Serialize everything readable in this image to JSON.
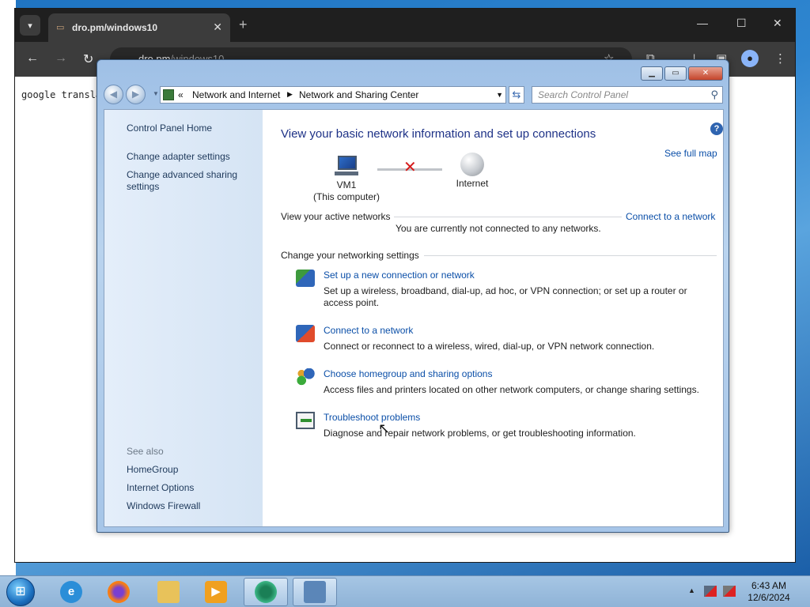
{
  "browser": {
    "tab_title": "dro.pm/windows10",
    "tab_close": "✕",
    "new_tab": "+",
    "url_host": "dro.pm",
    "url_path": "/windows10",
    "page_text": "google transla"
  },
  "cp": {
    "address": {
      "guillemet": "«",
      "crumb1": "Network and Internet",
      "crumb2": "Network and Sharing Center"
    },
    "search_placeholder": "Search Control Panel",
    "left_nav": {
      "home": "Control Panel Home",
      "adapter": "Change adapter settings",
      "advanced_line1": "Change advanced sharing",
      "advanced_line2": "settings",
      "see_also": "See also",
      "homegroup": "HomeGroup",
      "internet_options": "Internet Options",
      "firewall": "Windows Firewall"
    },
    "main": {
      "title": "View your basic network information and set up connections",
      "see_full_map": "See full map",
      "node_computer_name": "VM1",
      "node_computer_sub": "(This computer)",
      "node_internet": "Internet",
      "active_networks_label": "View your active networks",
      "connect_link": "Connect to a network",
      "not_connected": "You are currently not connected to any networks.",
      "change_settings_label": "Change your networking settings",
      "help": "?"
    },
    "tasks": [
      {
        "link": "Set up a new connection or network",
        "desc": "Set up a wireless, broadband, dial-up, ad hoc, or VPN connection; or set up a router or access point."
      },
      {
        "link": "Connect to a network",
        "desc": "Connect or reconnect to a wireless, wired, dial-up, or VPN network connection."
      },
      {
        "link": "Choose homegroup and sharing options",
        "desc": "Access files and printers located on other network computers, or change sharing settings."
      },
      {
        "link": "Troubleshoot problems",
        "desc": "Diagnose and repair network problems, or get troubleshooting information."
      }
    ]
  },
  "taskbar": {
    "time": "6:43 AM",
    "date": "12/6/2024"
  },
  "colors": {
    "link": "#0b4fa8",
    "title": "#1e3287",
    "error_x": "#d51a1a"
  },
  "icons": [
    "chevron-down-icon",
    "back-icon",
    "forward-icon",
    "reload-icon",
    "extensions-icon",
    "star-icon",
    "profile-icon",
    "menu-icon",
    "search-icon",
    "help-icon",
    "refresh-icon"
  ]
}
